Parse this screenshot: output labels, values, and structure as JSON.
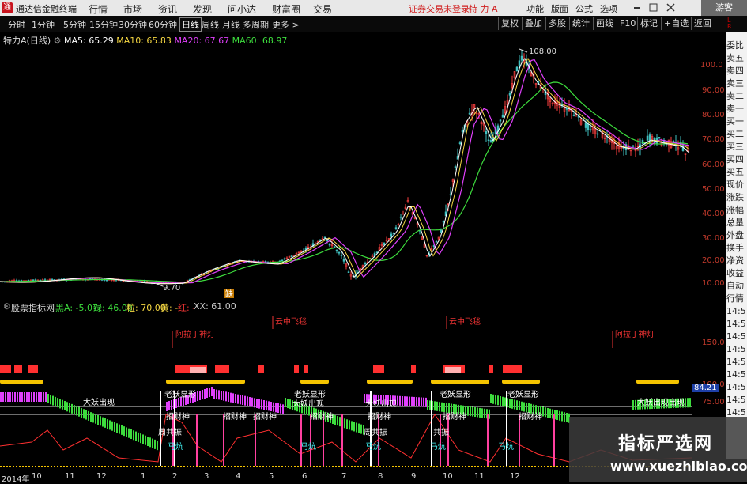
{
  "topbar": {
    "app_title": "通达信金融终端",
    "menus": [
      "行情",
      "市场",
      "资讯",
      "发现",
      "问小达",
      "财富圈",
      "交易"
    ],
    "login_status": "证券交易未登录",
    "stock_label": "特 力 A",
    "right_items": [
      "功能",
      "版面",
      "公式",
      "选项"
    ],
    "guest": "游客"
  },
  "toolbar": {
    "periods": [
      "分时",
      "1分钟",
      "5分钟",
      "15分钟",
      "30分钟",
      "60分钟",
      "日线",
      "周线",
      "月线",
      "多周期",
      "更多 >"
    ],
    "active_period": "日线",
    "buttons": [
      "复权",
      "叠加",
      "多股",
      "统计",
      "画线",
      "F10",
      "标记",
      "+自选",
      "返回"
    ]
  },
  "main_chart": {
    "stock": "特力A",
    "period_tag": "(日线)",
    "ma": [
      {
        "label": "MA5: 65.29",
        "color": "#ffffff"
      },
      {
        "label": "MA10: 65.83",
        "color": "#f5d742"
      },
      {
        "label": "MA20: 67.67",
        "color": "#e040fb"
      },
      {
        "label": "MA60: 68.97",
        "color": "#3ddc3d"
      }
    ],
    "high_marker": "108.00",
    "low_marker": "9.70",
    "event_marker": "缺",
    "price_ticks": [
      "100.0",
      "90.00",
      "80.00",
      "70.00",
      "60.00",
      "50.00",
      "40.00",
      "30.00",
      "20.00",
      "10.00"
    ]
  },
  "right_panel": [
    "委比",
    "卖五",
    "卖四",
    "卖三",
    "卖二",
    "卖一",
    "买一",
    "买二",
    "买三",
    "买四",
    "买五",
    "现价",
    "涨跌",
    "涨幅",
    "总量",
    "外盘",
    "换手",
    "净资",
    "收益",
    "自动",
    "行情",
    "14:5",
    "14:5",
    "14:5",
    "14:5",
    "14:5",
    "14:5",
    "14:5",
    "14:5",
    "14:5"
  ],
  "right_panel_header": "L\nR",
  "indicator": {
    "name": "股票指标网",
    "items": [
      {
        "label": "黑A: -5.07",
        "color": "#3ddc3d"
      },
      {
        "label": "绿: 46.00",
        "color": "#3ddc3d"
      },
      {
        "label": "粒: 70.00",
        "color": "#f5d742"
      },
      {
        "label": "黄: -",
        "color": "#f5d742"
      },
      {
        "label": "红: -",
        "color": "#e33"
      },
      {
        "label": "XX: 61.00",
        "color": "#ccc"
      }
    ],
    "signals": {
      "yunzhong1": "云中飞毯",
      "yunzhong2": "云中飞毯",
      "ala1": "阿拉丁神灯",
      "ala2": "阿拉丁神灯",
      "laoyao": [
        "老妖显形",
        "老妖显形",
        "老妖显形",
        "老妖显形"
      ],
      "dayao": [
        "大妖出现",
        "大妖出现",
        "大妖出现",
        "大妖出现出现"
      ],
      "zhaocai": [
        "招财神",
        "招财神",
        "招财神",
        "招财神",
        "招财神",
        "招财神",
        "招财神"
      ],
      "gongzhen": [
        "周共振",
        "周共振",
        "共振",
        "共振"
      ],
      "mahang": [
        "马炕",
        "马炕",
        "马炕",
        "马炕",
        "马炕",
        "马炕"
      ]
    },
    "axis": [
      "150.0",
      "100.0",
      "75.00",
      "84.21"
    ]
  },
  "time_axis": [
    "2014年",
    "10",
    "11",
    "12",
    "1",
    "2",
    "3",
    "4",
    "5",
    "6",
    "7",
    "8",
    "9",
    "10",
    "11",
    "12"
  ],
  "watermark": {
    "cn": "指标严选网",
    "en": "www.xuezhibiao.com"
  }
}
